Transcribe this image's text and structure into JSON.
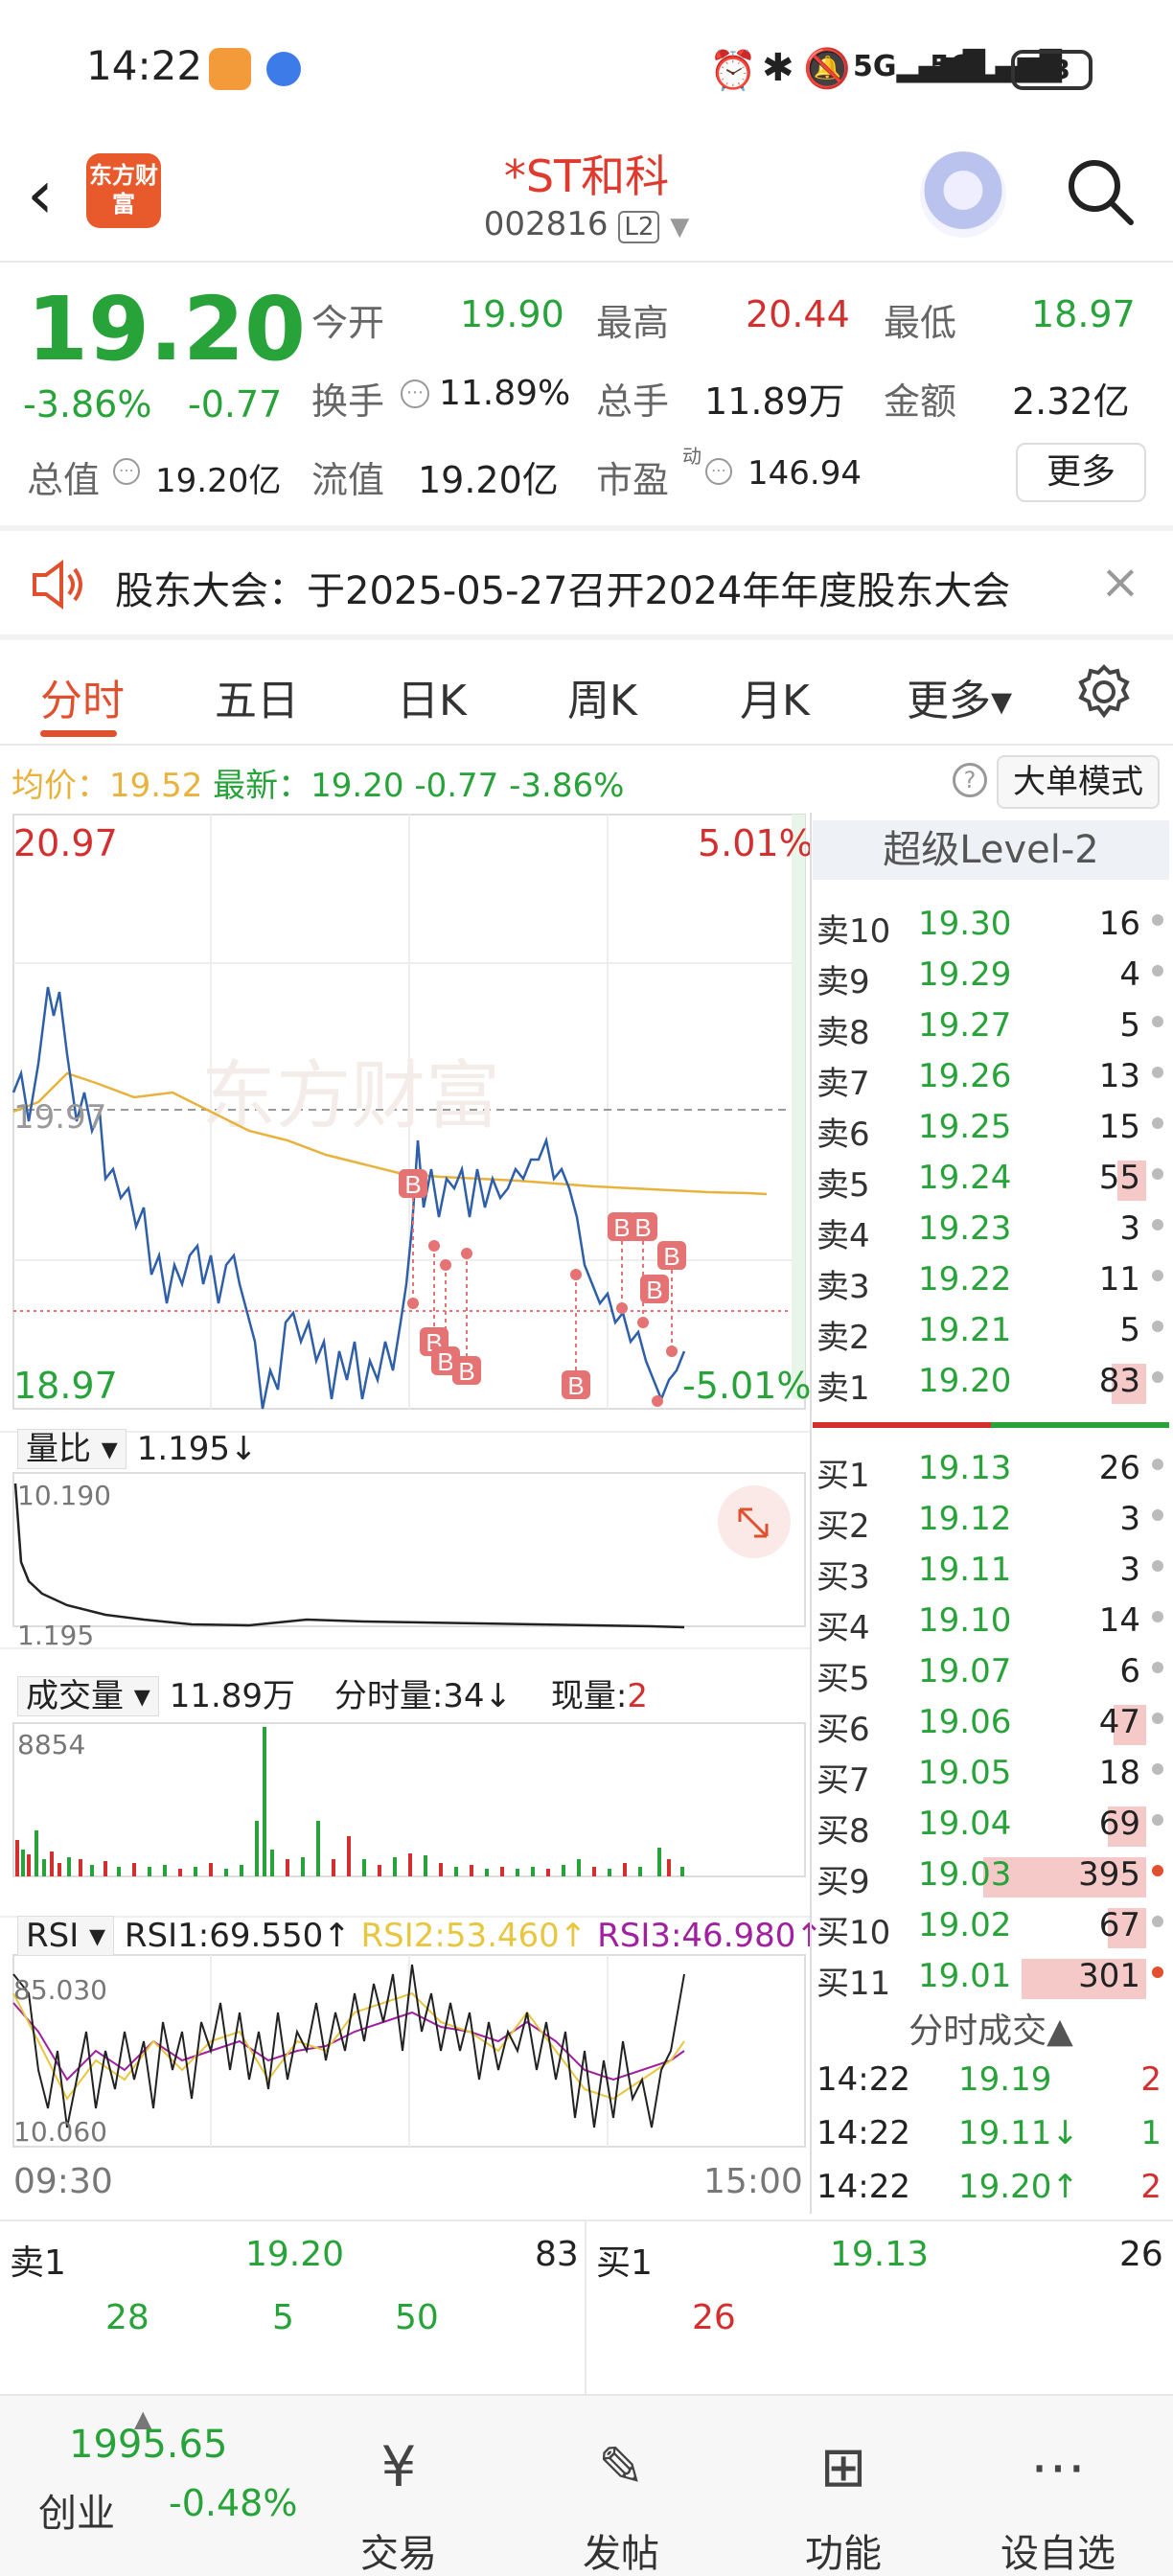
{
  "status": {
    "time": "14:22",
    "battery": "73"
  },
  "header": {
    "title": "*ST和科",
    "code": "002816",
    "level_badge": "L2",
    "logo_text": "东方财富",
    "back_icon": "back-icon",
    "search_icon": "search-icon"
  },
  "quote": {
    "price": "19.20",
    "change_pct": "-3.86%",
    "change": "-0.77",
    "open_label": "今开",
    "open": "19.90",
    "high_label": "最高",
    "high": "20.44",
    "low_label": "最低",
    "low": "18.97",
    "turnover_label": "换手",
    "turnover": "11.89%",
    "volume_label": "总手",
    "volume": "11.89万",
    "amount_label": "金额",
    "amount": "2.32亿",
    "mktcap_label": "总值",
    "mktcap": "19.20亿",
    "float_label": "流值",
    "float": "19.20亿",
    "pe_label": "市盈",
    "pe_sup": "动",
    "pe": "146.94",
    "more_button": "更多"
  },
  "notice": {
    "text": "股东大会：于2025-05-27召开2024年年度股东大会"
  },
  "tabs": [
    "分时",
    "五日",
    "日K",
    "周K",
    "月K",
    "更多▾"
  ],
  "info_line": {
    "avg_label": "均价：",
    "avg": "19.52",
    "latest_label": "最新：",
    "latest": "19.20",
    "chg": "-0.77",
    "pct": "-3.86%",
    "mode_button": "大单模式"
  },
  "chart": {
    "top_price": "20.97",
    "top_pct": "5.01%",
    "bottom_price": "18.97",
    "bottom_pct": "-5.01%",
    "mid_price": "19.97",
    "watermark": "东方财富",
    "ratio_label": "量比",
    "ratio_value": "1.195↓",
    "ratio_top": "10.190",
    "ratio_bottom": "1.195",
    "vol_label": "成交量",
    "vol_total": "11.89万",
    "vol_min_label": "分时量:34↓",
    "vol_now_label": "现量:",
    "vol_now": "2",
    "vol_max": "8854",
    "rsi_label": "RSI",
    "rsi1": "RSI1:69.550↑",
    "rsi2": "RSI2:53.460↑",
    "rsi3": "RSI3:46.980↑",
    "rsi_top": "85.030",
    "rsi_bottom": "10.060",
    "time_start": "09:30",
    "time_end": "15:00",
    "trade_marker": "B"
  },
  "level2": {
    "title": "超级Level-2",
    "asks": [
      {
        "label": "卖10",
        "price": "19.30",
        "vol": "16",
        "bar": 0.0
      },
      {
        "label": "卖9",
        "price": "19.29",
        "vol": "4",
        "bar": 0.0
      },
      {
        "label": "卖8",
        "price": "19.27",
        "vol": "5",
        "bar": 0.0
      },
      {
        "label": "卖7",
        "price": "19.26",
        "vol": "13",
        "bar": 0.0
      },
      {
        "label": "卖6",
        "price": "19.25",
        "vol": "15",
        "bar": 0.0
      },
      {
        "label": "卖5",
        "price": "19.24",
        "vol": "55",
        "bar": 0.05
      },
      {
        "label": "卖4",
        "price": "19.23",
        "vol": "3",
        "bar": 0.0
      },
      {
        "label": "卖3",
        "price": "19.22",
        "vol": "11",
        "bar": 0.0
      },
      {
        "label": "卖2",
        "price": "19.21",
        "vol": "5",
        "bar": 0.0
      },
      {
        "label": "卖1",
        "price": "19.20",
        "vol": "83",
        "bar": 0.08
      }
    ],
    "bids": [
      {
        "label": "买1",
        "price": "19.13",
        "vol": "26",
        "bar": 0.0
      },
      {
        "label": "买2",
        "price": "19.12",
        "vol": "3",
        "bar": 0.0
      },
      {
        "label": "买3",
        "price": "19.11",
        "vol": "3",
        "bar": 0.0
      },
      {
        "label": "买4",
        "price": "19.10",
        "vol": "14",
        "bar": 0.0
      },
      {
        "label": "买5",
        "price": "19.07",
        "vol": "6",
        "bar": 0.0
      },
      {
        "label": "买6",
        "price": "19.06",
        "vol": "47",
        "bar": 0.07
      },
      {
        "label": "买7",
        "price": "19.05",
        "vol": "18",
        "bar": 0.0
      },
      {
        "label": "买8",
        "price": "19.04",
        "vol": "69",
        "bar": 0.1
      },
      {
        "label": "买9",
        "price": "19.03",
        "vol": "395",
        "bar": 0.75
      },
      {
        "label": "买10",
        "price": "19.02",
        "vol": "67",
        "bar": 0.1
      },
      {
        "label": "买11",
        "price": "19.01",
        "vol": "301",
        "bar": 0.55
      }
    ],
    "ticks_title": "分时成交▲",
    "ticks": [
      {
        "time": "14:22",
        "price": "19.19",
        "vol": "2"
      },
      {
        "time": "14:22",
        "price": "19.11↓",
        "vol": "1"
      },
      {
        "time": "14:22",
        "price": "19.20↑",
        "vol": "2"
      }
    ]
  },
  "bottom_book": {
    "ask_label": "卖1",
    "ask_price": "19.20",
    "ask_vol": "83",
    "ask_queue": [
      "28",
      "5",
      "50"
    ],
    "bid_label": "买1",
    "bid_price": "19.13",
    "bid_vol": "26",
    "bid_queue": [
      "26"
    ]
  },
  "bottom_nav": {
    "index_value": "1995.65",
    "index_name": "创业",
    "index_pct": "-0.48%",
    "items": [
      "交易",
      "发帖",
      "功能",
      "设自选"
    ]
  },
  "colors": {
    "up": "#d32f2f",
    "down": "#27a33a",
    "accent": "#e0502e",
    "avg_line": "#e8b23c"
  }
}
